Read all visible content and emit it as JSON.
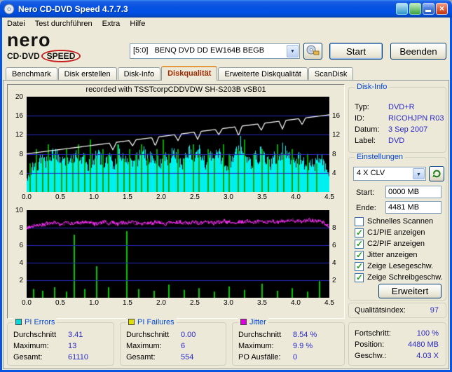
{
  "window": {
    "title": "Nero CD-DVD Speed 4.7.7.3"
  },
  "menu": {
    "items": [
      "Datei",
      "Test durchführen",
      "Extra",
      "Hilfe"
    ]
  },
  "logo": {
    "nero": "nero",
    "cddvd": "CD·DVD",
    "speed": "SPEED"
  },
  "toolbar": {
    "drive": "[5:0]   BENQ DVD DD EW164B BEGB",
    "start_label": "Start",
    "quit_label": "Beenden"
  },
  "tabs": [
    {
      "label": "Benchmark",
      "active": false
    },
    {
      "label": "Disk erstellen",
      "active": false
    },
    {
      "label": "Disk-Info",
      "active": false
    },
    {
      "label": "Diskqualität",
      "active": true
    },
    {
      "label": "Erweiterte Diskqualität",
      "active": false
    },
    {
      "label": "ScanDisk",
      "active": false
    }
  ],
  "chart_data": [
    {
      "name": "pie-and-speed",
      "type": "area",
      "title": "recorded with TSSTcorpCDDVDW SH-S203B vSB01",
      "x_ticks": [
        "0.0",
        "0.5",
        "1.0",
        "1.5",
        "2.0",
        "2.5",
        "3.0",
        "3.5",
        "4.0",
        "4.5"
      ],
      "ylim": [
        0,
        20
      ],
      "grid_step": 4,
      "y_labels_left": [
        "20",
        "16",
        "12",
        "8",
        "4"
      ],
      "y_labels_right": [
        "16",
        "12",
        "8",
        "4"
      ],
      "bg": "#000000",
      "grid_color": "#2A2AC0",
      "pie_color": "#00F0F0",
      "pie_values": [
        3,
        5,
        7,
        6,
        8,
        9,
        7,
        8,
        10,
        9,
        8,
        7,
        9,
        8,
        10,
        11,
        9,
        8,
        7,
        8,
        9,
        10,
        8,
        7,
        9,
        8,
        7,
        10,
        9,
        8,
        9,
        7,
        8,
        9,
        11,
        9,
        8,
        10,
        9,
        7,
        8,
        9,
        8,
        10,
        9,
        8,
        7,
        9,
        10,
        8,
        9,
        11,
        8,
        7,
        9,
        8,
        10,
        9,
        8,
        7,
        8,
        9,
        10,
        13,
        9,
        8,
        7,
        9,
        8,
        10,
        9,
        8,
        7,
        9,
        8,
        10,
        11,
        9,
        8,
        7,
        9,
        8,
        7,
        6,
        8,
        7,
        9,
        8,
        6,
        4
      ],
      "spike_color": "#00A400",
      "spikes": [
        [
          0.01,
          6
        ],
        [
          0.03,
          9
        ],
        [
          0.05,
          7
        ],
        [
          0.07,
          10
        ],
        [
          0.09,
          8
        ],
        [
          0.115,
          6
        ],
        [
          0.13,
          9
        ],
        [
          0.15,
          7
        ],
        [
          0.17,
          10
        ],
        [
          0.19,
          8
        ],
        [
          0.21,
          11
        ],
        [
          0.23,
          7
        ],
        [
          0.25,
          9
        ],
        [
          0.27,
          8
        ],
        [
          0.3,
          10
        ],
        [
          0.32,
          7
        ],
        [
          0.34,
          9
        ],
        [
          0.36,
          8
        ],
        [
          0.38,
          10
        ],
        [
          0.4,
          7
        ],
        [
          0.43,
          9
        ],
        [
          0.45,
          11
        ],
        [
          0.47,
          8
        ],
        [
          0.5,
          9
        ],
        [
          0.52,
          7
        ],
        [
          0.55,
          10
        ],
        [
          0.57,
          8
        ],
        [
          0.6,
          9
        ],
        [
          0.62,
          7
        ],
        [
          0.65,
          10
        ],
        [
          0.67,
          8
        ],
        [
          0.7,
          9
        ],
        [
          0.72,
          11
        ],
        [
          0.75,
          8
        ],
        [
          0.78,
          9
        ],
        [
          0.8,
          7
        ],
        [
          0.83,
          10
        ],
        [
          0.85,
          8
        ],
        [
          0.88,
          9
        ],
        [
          0.9,
          7
        ],
        [
          0.93,
          8
        ],
        [
          0.96,
          6
        ]
      ],
      "speed_color": "#FFFFFF",
      "speed_start": 8.0,
      "speed_end": 16.2,
      "speed_notches": [
        [
          0.285,
          1.5
        ],
        [
          0.35,
          1.2
        ],
        [
          0.425,
          1.8
        ],
        [
          0.5,
          1.3
        ],
        [
          0.565,
          1.6
        ],
        [
          0.635,
          1.2
        ],
        [
          0.7,
          1.9
        ],
        [
          0.775,
          1.4
        ],
        [
          0.845,
          1.7
        ],
        [
          0.91,
          1.3
        ]
      ]
    },
    {
      "name": "jitter-and-pif",
      "type": "line",
      "x_ticks": [
        "0.0",
        "0.5",
        "1.0",
        "1.5",
        "2.0",
        "2.5",
        "3.0",
        "3.5",
        "4.0",
        "4.5"
      ],
      "ylim": [
        0,
        10
      ],
      "grid_step": 2,
      "y_labels_left": [
        "10",
        "8",
        "6",
        "4",
        "2"
      ],
      "y_labels_right": [
        "8",
        "6",
        "4",
        "2"
      ],
      "bg": "#000000",
      "grid_color": "#2A2AC0",
      "jitter_color": "#FF30FF",
      "jitter_values": [
        7.9,
        8.1,
        8.2,
        8.3,
        8.4,
        8.3,
        8.5,
        8.4,
        8.6,
        8.5,
        8.4,
        8.5,
        8.6,
        8.5,
        8.4,
        8.6,
        8.5,
        8.7,
        8.5,
        8.6,
        8.4,
        8.5,
        8.6,
        8.7,
        8.5,
        8.6,
        8.5,
        8.4,
        8.6,
        8.5,
        8.7,
        8.6,
        8.5,
        8.6,
        8.4,
        8.5,
        8.6,
        8.5,
        8.7,
        8.6,
        8.5,
        8.4,
        8.6,
        8.5,
        8.6,
        8.7,
        8.5,
        8.6,
        8.5,
        8.7,
        8.6,
        8.5,
        8.6,
        8.7,
        8.6,
        8.5,
        8.7,
        8.6,
        8.8,
        8.6,
        8.7,
        8.5,
        8.6,
        8.7,
        8.6,
        8.8,
        8.7,
        8.6,
        8.7,
        8.8,
        8.6,
        8.7,
        8.8,
        8.7,
        8.6,
        8.8,
        8.7,
        8.8,
        8.9,
        8.7,
        8.8,
        8.7,
        8.8,
        8.9,
        8.8,
        8.7,
        8.8,
        8.6,
        8.4,
        8.2
      ],
      "pif_color": "#00C800",
      "pif_spikes": [
        [
          0.02,
          1.0
        ],
        [
          0.05,
          0.8
        ],
        [
          0.09,
          1.2
        ],
        [
          0.13,
          0.7
        ],
        [
          0.155,
          7.2
        ],
        [
          0.19,
          1.0
        ],
        [
          0.23,
          3.6
        ],
        [
          0.27,
          1.2
        ],
        [
          0.33,
          7.6
        ],
        [
          0.37,
          1.0
        ],
        [
          0.42,
          0.8
        ],
        [
          0.47,
          1.5
        ],
        [
          0.52,
          0.9
        ],
        [
          0.57,
          1.1
        ],
        [
          0.62,
          0.7
        ],
        [
          0.67,
          1.3
        ],
        [
          0.72,
          0.9
        ],
        [
          0.78,
          1.6
        ],
        [
          0.83,
          0.8
        ],
        [
          0.88,
          1.1
        ],
        [
          0.93,
          0.7
        ],
        [
          0.97,
          1.9
        ]
      ]
    }
  ],
  "disk_info": {
    "title": "Disk-Info",
    "rows": [
      {
        "label": "Typ:",
        "value": "DVD+R"
      },
      {
        "label": "ID:",
        "value": "RICOHJPN R03"
      },
      {
        "label": "Datum:",
        "value": "3 Sep 2007"
      },
      {
        "label": "Label:",
        "value": "DVD"
      }
    ]
  },
  "settings": {
    "title": "Einstellungen",
    "speed": "4 X CLV",
    "start_label": "Start:",
    "start_value": "0000 MB",
    "end_label": "Ende:",
    "end_value": "4481 MB",
    "checkboxes": [
      {
        "label": "Schnelles Scannen",
        "checked": false
      },
      {
        "label": "C1/PIE anzeigen",
        "checked": true
      },
      {
        "label": "C2/PIF anzeigen",
        "checked": true
      },
      {
        "label": "Jitter anzeigen",
        "checked": true
      },
      {
        "label": "Zeige Lesegeschw.",
        "checked": true
      },
      {
        "label": "Zeige Schreibgeschw.",
        "checked": true
      }
    ],
    "advanced_label": "Erweitert"
  },
  "quality": {
    "label": "Qualitätsindex:",
    "value": "97"
  },
  "progress": {
    "rows": [
      {
        "label": "Fortschritt:",
        "value": "100 %"
      },
      {
        "label": "Position:",
        "value": "4480 MB"
      },
      {
        "label": "Geschw.:",
        "value": "4.03 X"
      }
    ]
  },
  "stats": [
    {
      "title": "PI Errors",
      "color": "#00DADA",
      "rows": [
        {
          "label": "Durchschnitt",
          "value": "3.41"
        },
        {
          "label": "Maximum:",
          "value": "13"
        },
        {
          "label": "Gesamt:",
          "value": "61110"
        }
      ]
    },
    {
      "title": "PI Failures",
      "color": "#DEDE00",
      "rows": [
        {
          "label": "Durchschnitt",
          "value": "0.00"
        },
        {
          "label": "Maximum:",
          "value": "6"
        },
        {
          "label": "Gesamt:",
          "value": "554"
        }
      ]
    },
    {
      "title": "Jitter",
      "color": "#DE00DE",
      "rows": [
        {
          "label": "Durchschnitt",
          "value": "8.54 %"
        },
        {
          "label": "Maximum:",
          "value": "9.9 %"
        },
        {
          "label": "PO Ausfälle:",
          "value": "0"
        }
      ]
    }
  ]
}
